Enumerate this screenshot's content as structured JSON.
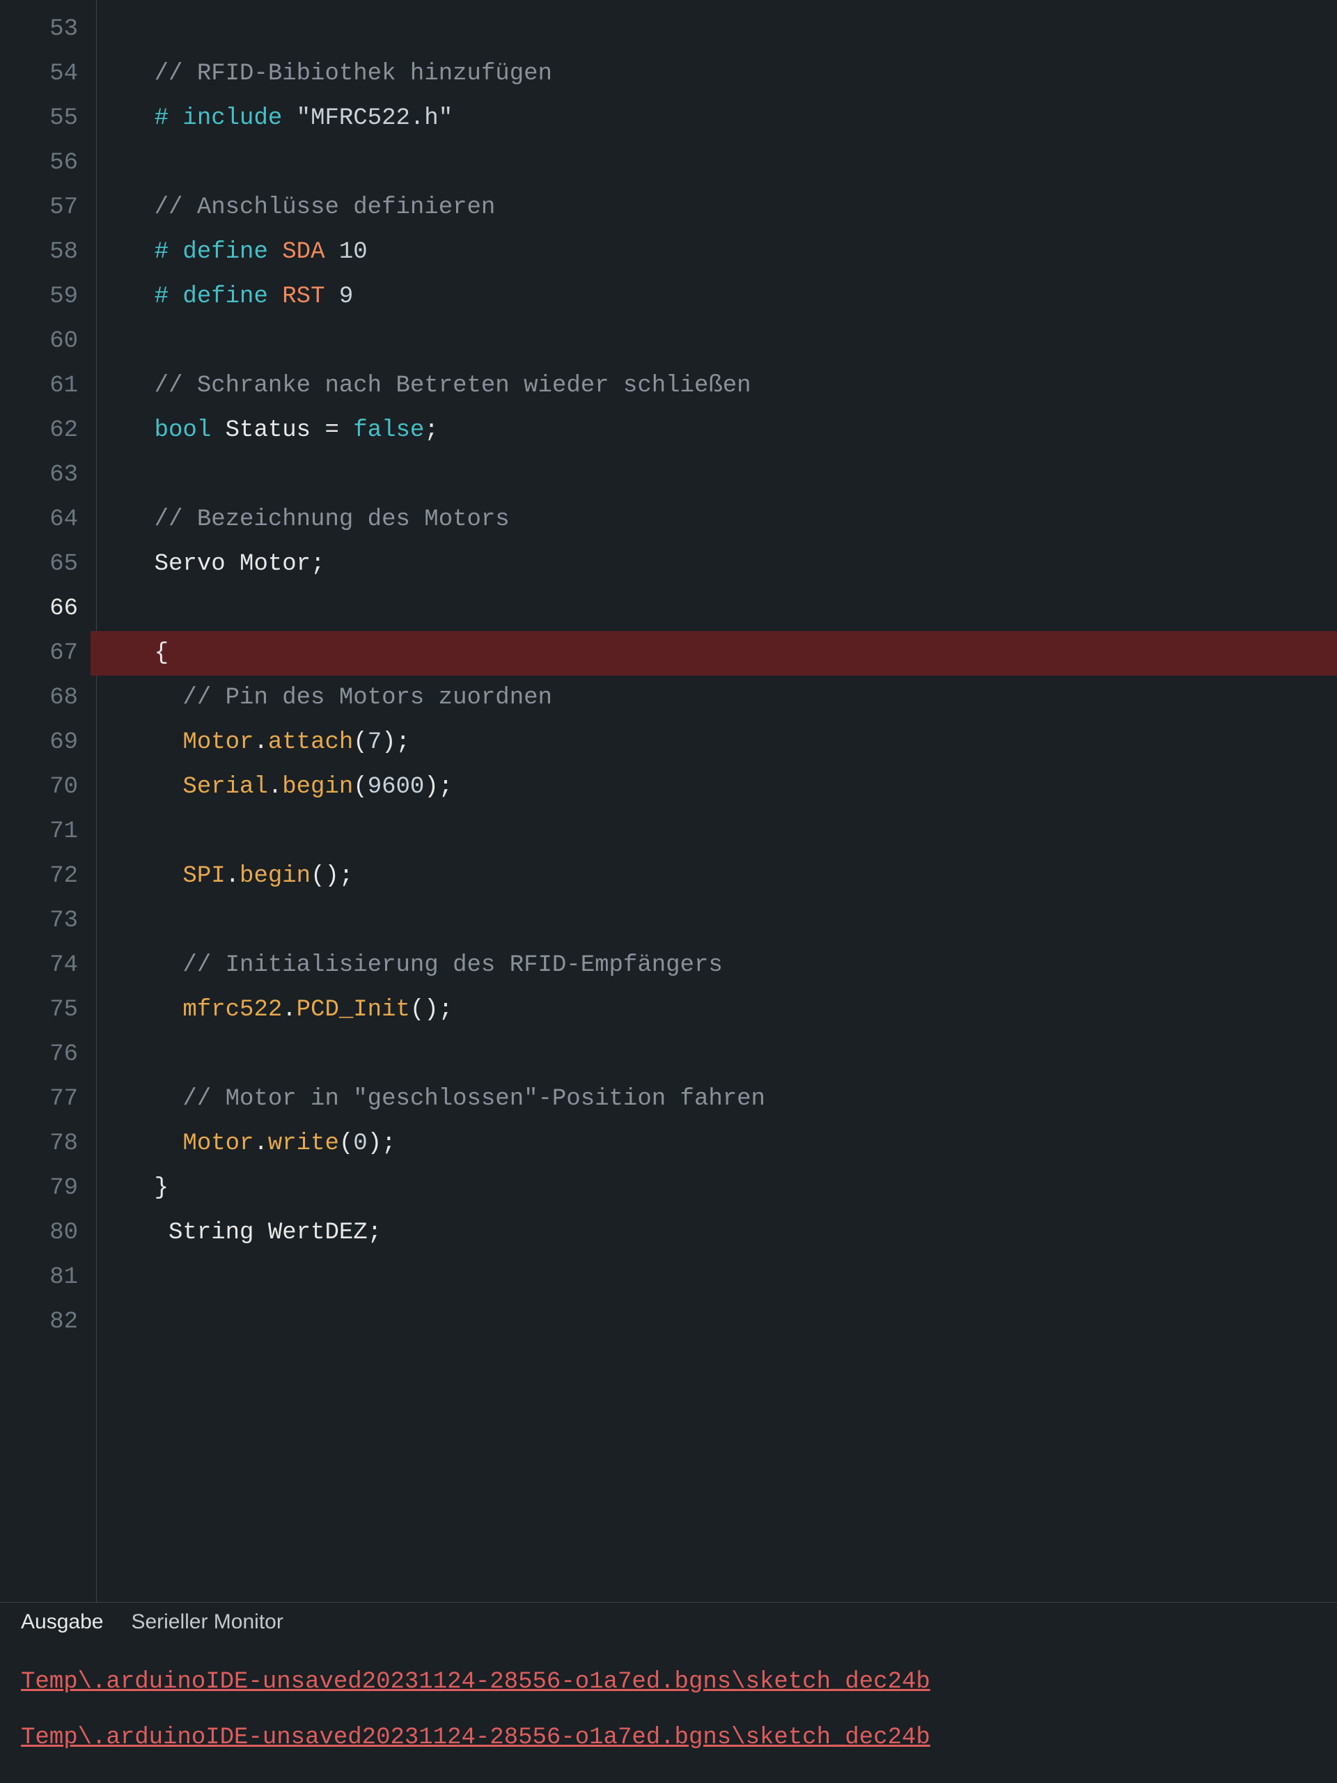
{
  "gutter_start": 53,
  "gutter_end": 82,
  "current_line": 66,
  "error_line": 67,
  "lines": {
    "53": "",
    "54": {
      "indent": "    ",
      "tokens": [
        [
          "comment",
          "// RFID-Bibiothek hinzufügen"
        ]
      ]
    },
    "55": {
      "indent": "    ",
      "tokens": [
        [
          "pre",
          "# include "
        ],
        [
          "quoted",
          "\"MFRC522.h\""
        ]
      ]
    },
    "56": "",
    "57": {
      "indent": "    ",
      "tokens": [
        [
          "comment",
          "// Anschlüsse definieren"
        ]
      ]
    },
    "58": {
      "indent": "    ",
      "tokens": [
        [
          "pre",
          "# define "
        ],
        [
          "define-word",
          "SDA "
        ],
        [
          "num",
          "10"
        ]
      ]
    },
    "59": {
      "indent": "    ",
      "tokens": [
        [
          "pre",
          "# define "
        ],
        [
          "define-word",
          "RST "
        ],
        [
          "num",
          "9"
        ]
      ]
    },
    "60": "",
    "61": {
      "indent": "    ",
      "tokens": [
        [
          "comment",
          "// Schranke nach Betreten wieder schließen"
        ]
      ]
    },
    "62": {
      "indent": "    ",
      "tokens": [
        [
          "type",
          "bool "
        ],
        [
          "ident",
          "Status "
        ],
        [
          "plain",
          "= "
        ],
        [
          "false",
          "false"
        ],
        [
          "plain",
          ";"
        ]
      ]
    },
    "63": "",
    "64": {
      "indent": "    ",
      "tokens": [
        [
          "comment",
          "// Bezeichnung des Motors"
        ]
      ]
    },
    "65": {
      "indent": "    ",
      "tokens": [
        [
          "ident",
          "Servo Motor"
        ],
        [
          "plain",
          ";"
        ]
      ]
    },
    "66": "",
    "67": {
      "indent": "    ",
      "tokens": [
        [
          "plain",
          "{"
        ]
      ]
    },
    "68": {
      "indent": "      ",
      "tokens": [
        [
          "comment",
          "// Pin des Motors zuordnen"
        ]
      ]
    },
    "69": {
      "indent": "      ",
      "tokens": [
        [
          "obj",
          "Motor"
        ],
        [
          "plain",
          "."
        ],
        [
          "call",
          "attach"
        ],
        [
          "plain",
          "("
        ],
        [
          "num",
          "7"
        ],
        [
          "plain",
          ");"
        ]
      ]
    },
    "70": {
      "indent": "      ",
      "tokens": [
        [
          "obj",
          "Serial"
        ],
        [
          "plain",
          "."
        ],
        [
          "call",
          "begin"
        ],
        [
          "plain",
          "("
        ],
        [
          "num",
          "9600"
        ],
        [
          "plain",
          ");"
        ]
      ]
    },
    "71": "",
    "72": {
      "indent": "      ",
      "tokens": [
        [
          "obj",
          "SPI"
        ],
        [
          "plain",
          "."
        ],
        [
          "call",
          "begin"
        ],
        [
          "plain",
          "();"
        ]
      ]
    },
    "73": "",
    "74": {
      "indent": "      ",
      "tokens": [
        [
          "comment",
          "// Initialisierung des RFID-Empfängers"
        ]
      ]
    },
    "75": {
      "indent": "      ",
      "tokens": [
        [
          "obj",
          "mfrc522"
        ],
        [
          "plain",
          "."
        ],
        [
          "call",
          "PCD_Init"
        ],
        [
          "plain",
          "();"
        ]
      ]
    },
    "76": "",
    "77": {
      "indent": "      ",
      "tokens": [
        [
          "comment",
          "// Motor in \"geschlossen\"-Position fahren"
        ]
      ]
    },
    "78": {
      "indent": "      ",
      "tokens": [
        [
          "obj",
          "Motor"
        ],
        [
          "plain",
          "."
        ],
        [
          "call",
          "write"
        ],
        [
          "plain",
          "("
        ],
        [
          "num",
          "0"
        ],
        [
          "plain",
          ");"
        ]
      ]
    },
    "79": {
      "indent": "    ",
      "tokens": [
        [
          "plain",
          "}"
        ]
      ]
    },
    "80": {
      "indent": "     ",
      "tokens": [
        [
          "ident",
          "String WertDEZ"
        ],
        [
          "plain",
          ";"
        ]
      ]
    },
    "81": "",
    "82": ""
  },
  "panel": {
    "tabs": {
      "output": "Ausgabe",
      "serial": "Serieller Monitor"
    },
    "errors": [
      "Temp\\.arduinoIDE-unsaved20231124-28556-o1a7ed.bgns\\sketch_dec24b",
      "Temp\\.arduinoIDE-unsaved20231124-28556-o1a7ed.bgns\\sketch_dec24b"
    ]
  }
}
